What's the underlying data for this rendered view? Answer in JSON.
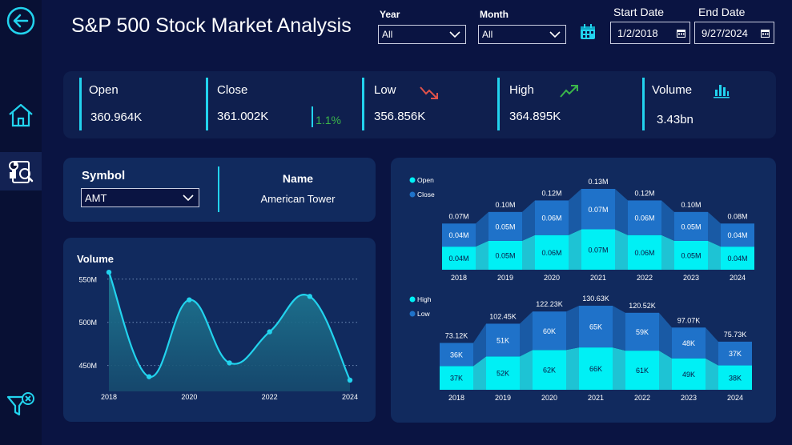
{
  "header": {
    "title": "S&P 500 Stock Market Analysis"
  },
  "filters": {
    "year_label": "Year",
    "year_value": "All",
    "month_label": "Month",
    "month_value": "All",
    "start_label": "Start Date",
    "start_value": "1/2/2018",
    "end_label": "End Date",
    "end_value": "9/27/2024"
  },
  "kpis": {
    "open": {
      "label": "Open",
      "value": "360.964K"
    },
    "close": {
      "label": "Close",
      "value": "361.002K",
      "change": "1.1%"
    },
    "low": {
      "label": "Low",
      "value": "356.856K"
    },
    "high": {
      "label": "High",
      "value": "364.895K"
    },
    "volume": {
      "label": "Volume",
      "value": "3.43bn"
    }
  },
  "symbol": {
    "label": "Symbol",
    "value": "AMT",
    "name_label": "Name",
    "name_value": "American Tower"
  },
  "icons": [
    "back-arrow-icon",
    "home-icon",
    "analysis-report-icon",
    "clear-filter-icon",
    "calendar-icon",
    "trend-down-icon",
    "trend-up-icon",
    "bar-chart-icon",
    "chevron-down-icon"
  ],
  "colors": {
    "background": "#0a1442",
    "panel": "#112a5e",
    "accent": "#22d3ee",
    "positive": "#3bb54a",
    "negative": "#e0524a"
  },
  "chart_data": [
    {
      "type": "area",
      "title": "Volume",
      "x": [
        2018,
        2019,
        2020,
        2021,
        2022,
        2023,
        2024
      ],
      "x_tick_labels": [
        "2018",
        "2020",
        "2022",
        "2024"
      ],
      "y_tick_labels": [
        "450M",
        "500M",
        "550M"
      ],
      "ylim": [
        420,
        560
      ],
      "series": [
        {
          "values": [
            558,
            437,
            526,
            453,
            489,
            530,
            433
          ]
        }
      ],
      "grid": true
    },
    {
      "type": "bar",
      "stacked": true,
      "categories": [
        "2018",
        "2019",
        "2020",
        "2021",
        "2022",
        "2023",
        "2024"
      ],
      "series": [
        {
          "name": "Open",
          "values": [
            0.04,
            0.05,
            0.06,
            0.07,
            0.06,
            0.05,
            0.04
          ],
          "labels": [
            "0.04M",
            "0.05M",
            "0.06M",
            "0.07M",
            "0.06M",
            "0.05M",
            "0.04M"
          ]
        },
        {
          "name": "Close",
          "values": [
            0.04,
            0.05,
            0.06,
            0.07,
            0.06,
            0.05,
            0.04
          ],
          "labels": [
            "0.04M",
            "0.05M",
            "0.06M",
            "0.07M",
            "0.06M",
            "0.05M",
            "0.04M"
          ]
        }
      ],
      "totals": [
        "0.07M",
        "0.10M",
        "0.12M",
        "0.13M",
        "0.12M",
        "0.10M",
        "0.08M"
      ],
      "legend": "top-left"
    },
    {
      "type": "bar",
      "stacked": true,
      "categories": [
        "2018",
        "2019",
        "2020",
        "2021",
        "2022",
        "2023",
        "2024"
      ],
      "series": [
        {
          "name": "High",
          "values": [
            37,
            52,
            62,
            66,
            61,
            49,
            38
          ],
          "labels": [
            "37K",
            "52K",
            "62K",
            "66K",
            "61K",
            "49K",
            "38K"
          ]
        },
        {
          "name": "Low",
          "values": [
            36,
            51,
            60,
            65,
            59,
            48,
            37
          ],
          "labels": [
            "36K",
            "51K",
            "60K",
            "65K",
            "59K",
            "48K",
            "37K"
          ]
        }
      ],
      "totals": [
        "73.12K",
        "102.45K",
        "122.23K",
        "130.63K",
        "120.52K",
        "97.07K",
        "75.73K"
      ],
      "legend": "top-left"
    }
  ]
}
